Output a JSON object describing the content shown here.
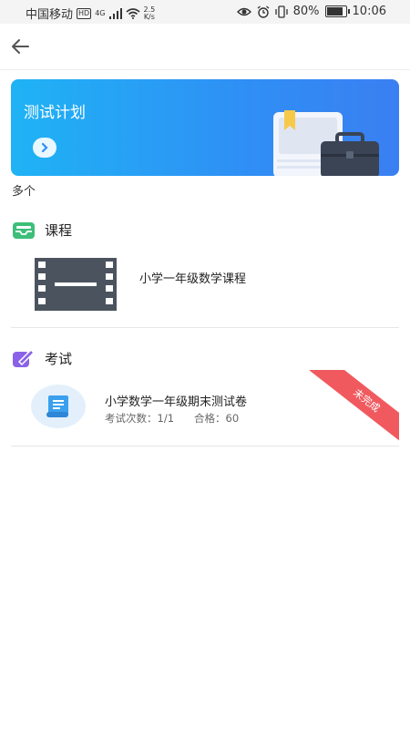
{
  "status_bar": {
    "carrier": "中国移动",
    "hd_badge": "HD",
    "network": "4G",
    "speed_value": "2.5",
    "speed_unit": "K/s",
    "battery": "80%",
    "time": "10:06",
    "battery_level": 0.8
  },
  "header": {
    "back_icon": "arrow-left-icon"
  },
  "banner": {
    "title": "测试计划",
    "arrow_icon": "chevron-right-icon",
    "accent": "#2f8ff5"
  },
  "count_label": "多个",
  "course_section": {
    "title": "课程",
    "icon_color": "#3dbf7a",
    "items": [
      {
        "name": "小学一年级数学课程"
      }
    ]
  },
  "exam_section": {
    "title": "考试",
    "icon_color": "#8a62e8",
    "items": [
      {
        "name": "小学数学一年级期末测试卷",
        "attempts_label": "考试次数：1/1",
        "pass_label": "合格：60",
        "status": "未完成",
        "status_color": "#f05a5f"
      }
    ]
  }
}
